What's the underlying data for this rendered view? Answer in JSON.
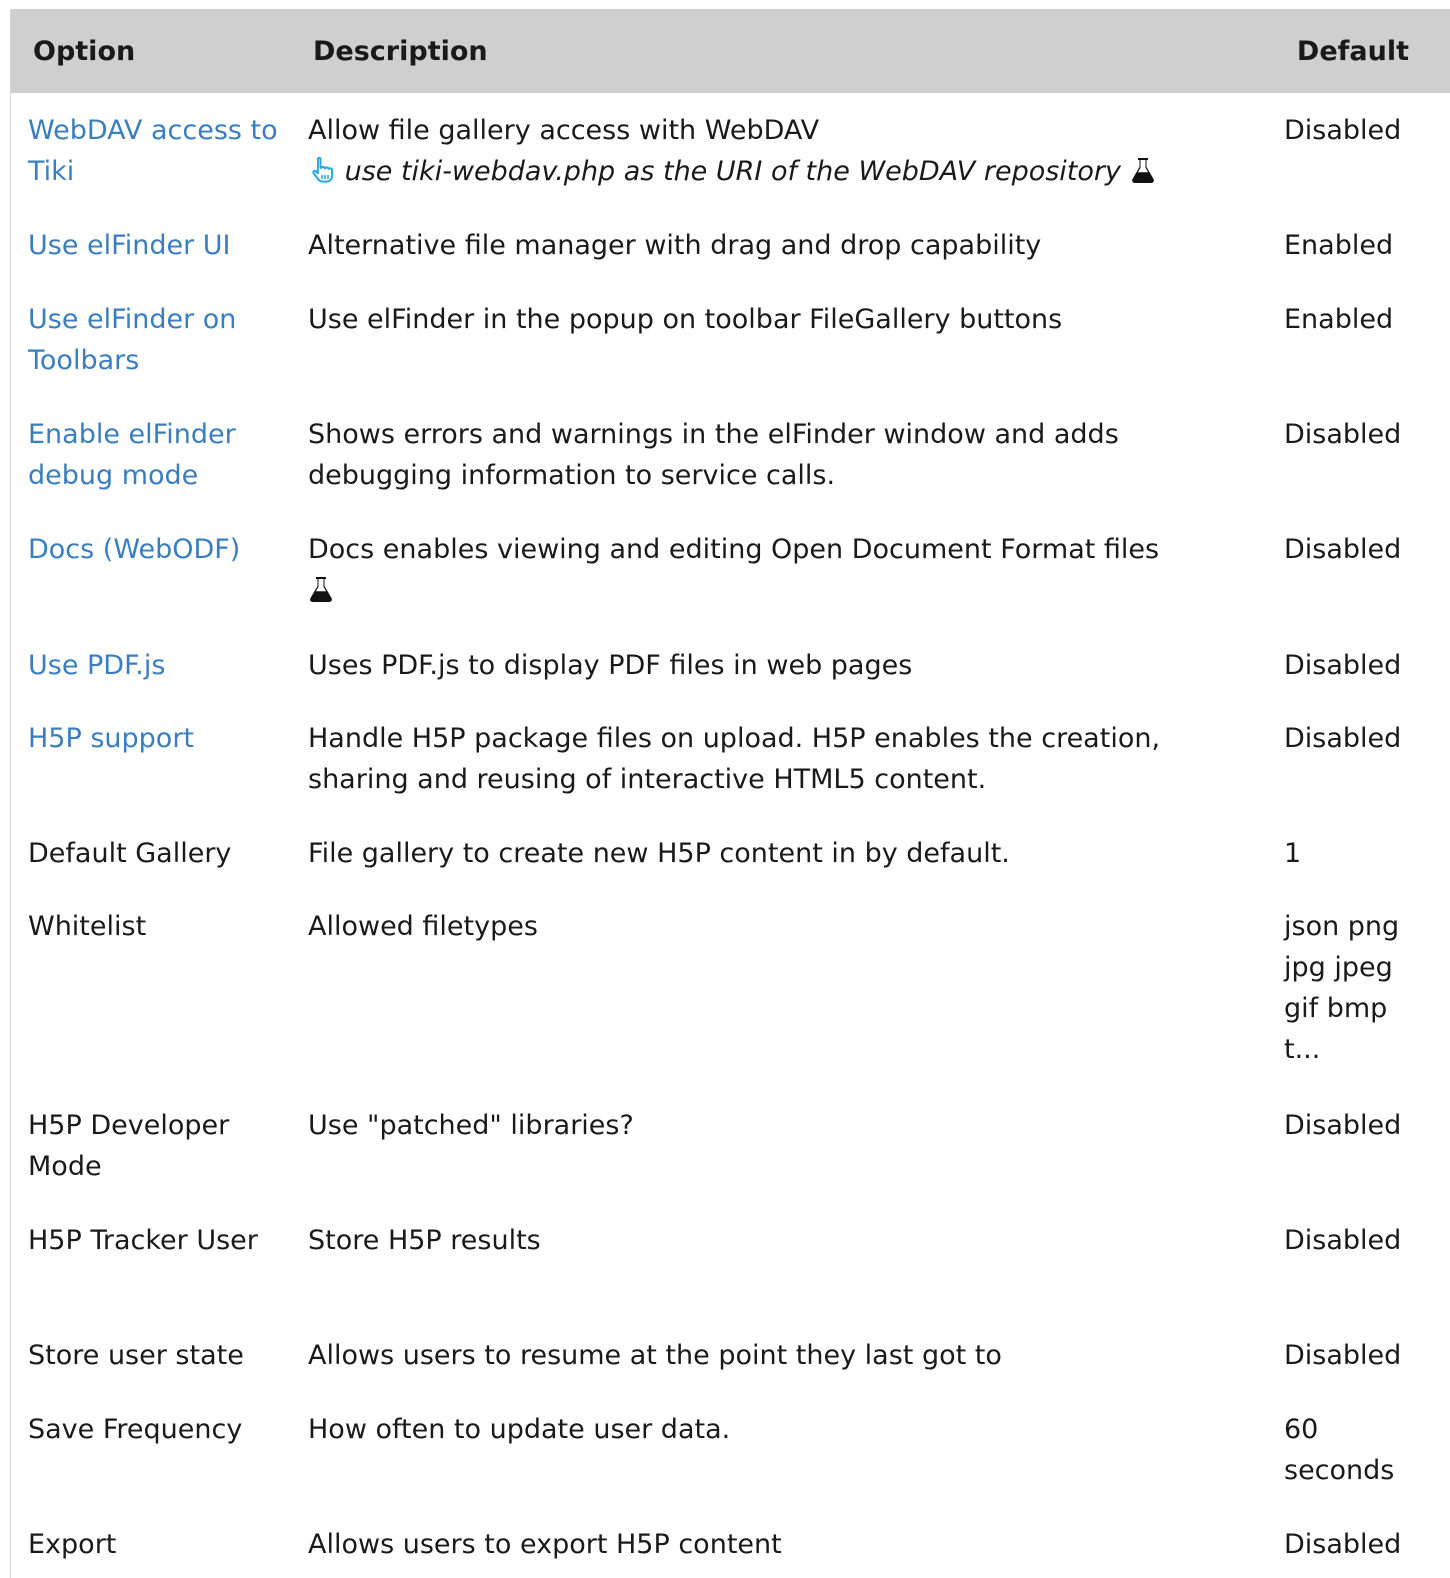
{
  "table": {
    "headers": {
      "option": "Option",
      "description": "Description",
      "default": "Default"
    },
    "rows": [
      {
        "option": "WebDAV access to Tiki",
        "description": "Allow file gallery access with WebDAV",
        "hint": "use tiki-webdav.php as the URI of the WebDAV repository",
        "default": "Disabled",
        "link": true
      },
      {
        "option": "Use elFinder UI",
        "description": "Alternative file manager with drag and drop capability",
        "default": "Enabled",
        "link": true
      },
      {
        "option": "Use elFinder on Toolbars",
        "description": "Use elFinder in the popup on toolbar FileGallery buttons",
        "default": "Enabled",
        "link": true
      },
      {
        "option": "Enable elFinder debug mode",
        "description": "Shows errors and warnings in the elFinder window and adds debugging information to service calls.",
        "default": "Disabled",
        "link": true
      },
      {
        "option": "Docs (WebODF)",
        "description": "Docs enables viewing and editing Open Document Format files",
        "default": "Disabled",
        "link": true
      },
      {
        "option": "Use PDF.js",
        "description": "Uses PDF.js to display PDF files in web pages",
        "default": "Disabled",
        "link": true
      },
      {
        "option": "H5P support",
        "description": "Handle H5P package files on upload. H5P enables the creation, sharing and reusing of interactive HTML5 content.",
        "default": "Disabled",
        "link": true
      },
      {
        "option": "Default Gallery",
        "description": "File gallery to create new H5P content in by default.",
        "default": "1",
        "link": false
      },
      {
        "option": "Whitelist",
        "description": "Allowed filetypes",
        "default": "json png jpg jpeg gif bmp t...",
        "link": false
      },
      {
        "option": "H5P Developer Mode",
        "description": "Use \"patched\" libraries?",
        "default": "Disabled",
        "link": false
      },
      {
        "option": "H5P Tracker User",
        "description": "Store H5P results",
        "default": "Disabled",
        "link": false
      },
      {
        "option": "Store user state",
        "description": "Allows users to resume at the point they last got to",
        "default": "Disabled",
        "link": false
      },
      {
        "option": "Save Frequency",
        "description": "How often to update user data.",
        "default": "60 seconds",
        "link": false
      },
      {
        "option": "Export",
        "description": "Allows users to export H5P content",
        "default": "Disabled",
        "link": false
      }
    ]
  },
  "icons": {
    "hand": "pointing-hand-icon",
    "experimental": "flask-icon"
  },
  "colors": {
    "link": "#3a7ebf",
    "header_bg": "#cfcfcf",
    "hand_icon": "#29a8e0"
  }
}
